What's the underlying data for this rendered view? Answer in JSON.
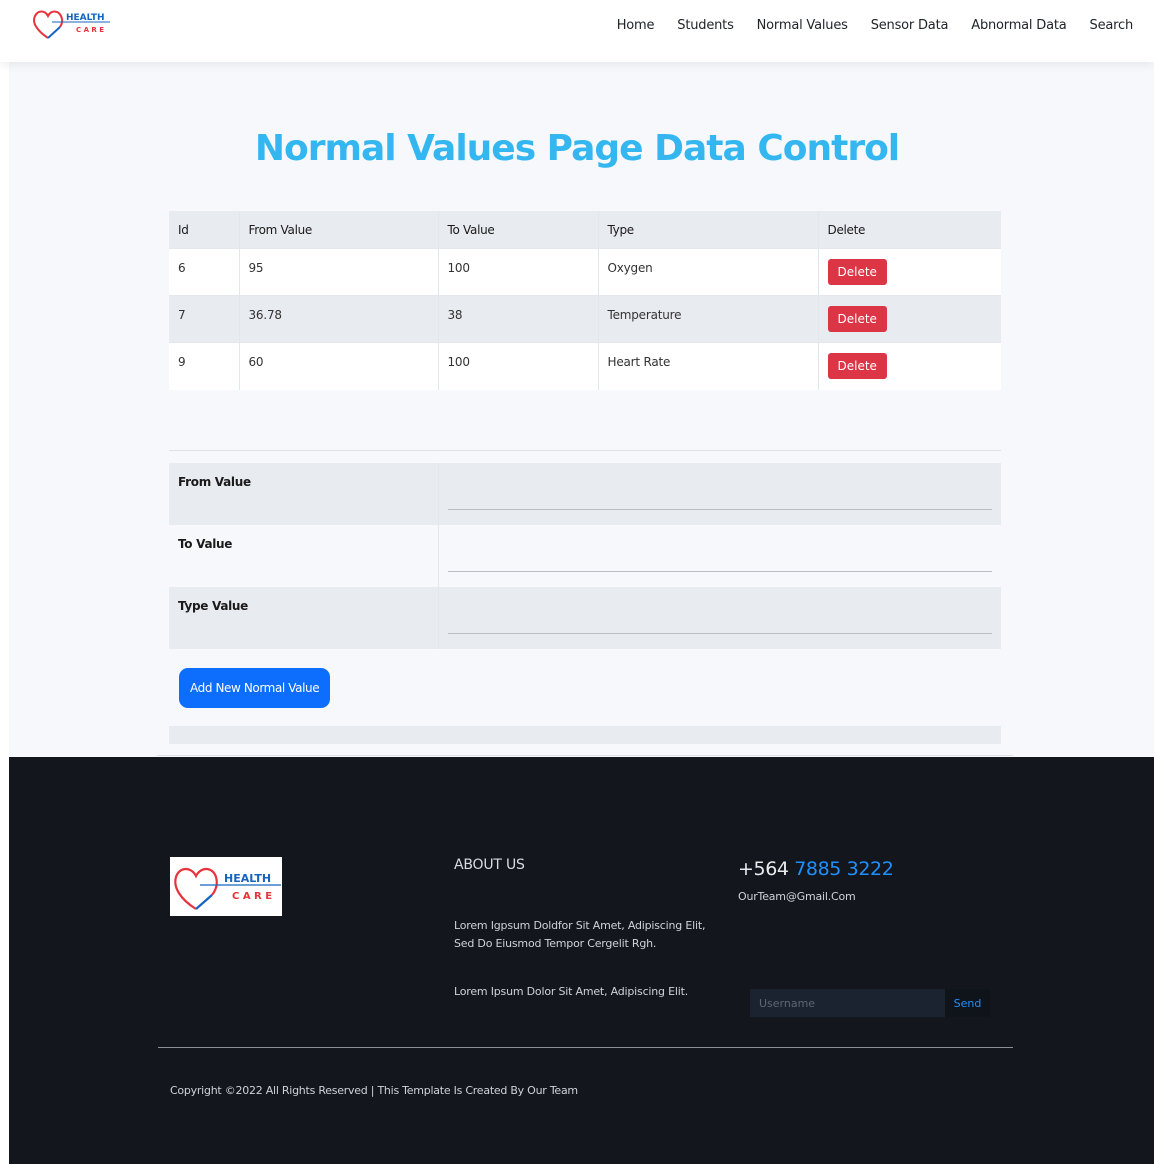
{
  "brand": {
    "logo_word_top": "HEALTH",
    "logo_word_bottom": "C A R E",
    "colors": {
      "heart": "#e8323c",
      "text_top": "#1565c0",
      "text_bottom": "#e8323c",
      "line": "#e8323c"
    }
  },
  "nav": {
    "items": [
      {
        "label": "Home"
      },
      {
        "label": "Students"
      },
      {
        "label": "Normal Values"
      },
      {
        "label": "Sensor Data"
      },
      {
        "label": "Abnormal Data"
      },
      {
        "label": "Search"
      }
    ]
  },
  "main": {
    "title": "Normal Values Page Data Control",
    "table": {
      "headers": [
        "Id",
        "From Value",
        "To Value",
        "Type",
        "Delete"
      ],
      "rows": [
        {
          "id": "6",
          "from": "95",
          "to": "100",
          "type": "Oxygen",
          "action": "Delete"
        },
        {
          "id": "7",
          "from": "36.78",
          "to": "38",
          "type": "Temperature",
          "action": "Delete"
        },
        {
          "id": "9",
          "from": "60",
          "to": "100",
          "type": "Heart Rate",
          "action": "Delete"
        }
      ]
    },
    "form": {
      "from_label": "From Value",
      "from_value": "",
      "to_label": "To Value",
      "to_value": "",
      "type_label": "Type Value",
      "type_value": "",
      "submit_label": "Add New Normal Value"
    }
  },
  "footer": {
    "about_title": "ABOUT US",
    "about_text_1": "Lorem Igpsum Doldfor Sit Amet, Adipiscing Elit, Sed Do Eiusmod Tempor Cergelit Rgh.",
    "about_text_2": "Lorem Ipsum Dolor Sit Amet, Adipiscing Elit.",
    "phone_prefix": "+564",
    "phone_number": "7885 3222",
    "email": "OurTeam@Gmail.Com",
    "subscribe_placeholder": "Username",
    "subscribe_button": "Send",
    "copyright": "Copyright ©2022 All Rights Reserved | This Template Is Created By Our Team"
  },
  "colors": {
    "accent_title": "#34b7f1",
    "delete_button": "#dc3545",
    "primary_button": "#0d6efd",
    "footer_bg": "#13161c",
    "phone_number": "#1e90ff"
  }
}
